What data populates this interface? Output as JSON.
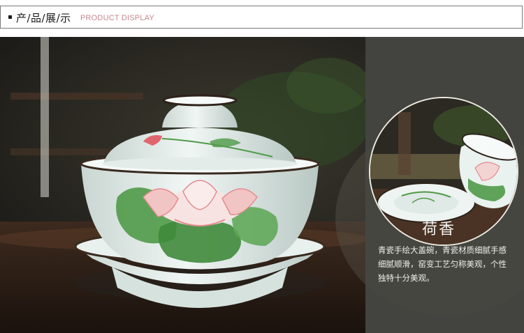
{
  "header": {
    "title_cn": "产/品/展/示",
    "title_en": "PRODUCT DISPLAY"
  },
  "product": {
    "name": "荷香",
    "description": "青瓷手绘大盖碗，青瓷材质细腻手感细腻顺滑，窑变工艺匀称美观，个性独特十分美观。"
  },
  "colors": {
    "accent": "#c9878f",
    "panel": "#464642",
    "porcelain": "#e6efec",
    "lotus_pink": "#e58a8e",
    "leaf_green": "#4f9a48"
  }
}
